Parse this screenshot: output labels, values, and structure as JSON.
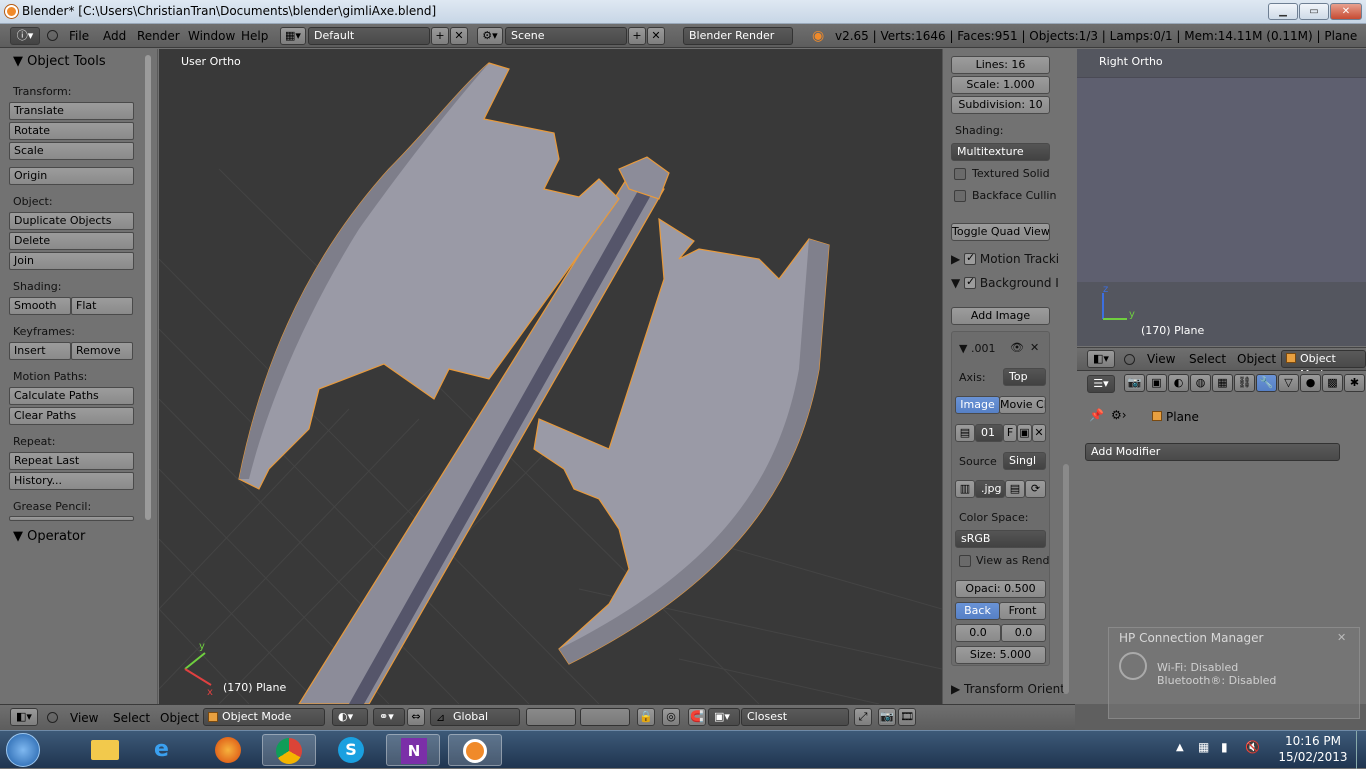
{
  "window": {
    "title": "Blender* [C:\\Users\\ChristianTran\\Documents\\blender\\gimliAxe.blend]",
    "minimize": "▁",
    "maximize": "▭",
    "close": "✕"
  },
  "topbar": {
    "menus": [
      "File",
      "Add",
      "Render",
      "Window",
      "Help"
    ],
    "screen_layout": "Default",
    "scene": "Scene",
    "render_engine": "Blender Render",
    "stats": "v2.65 | Verts:1646 | Faces:951 | Objects:1/3 | Lamps:0/1 | Mem:14.11M (0.11M) | Plane"
  },
  "tool_panel": {
    "title": "Object Tools",
    "transform_label": "Transform:",
    "translate": "Translate",
    "rotate": "Rotate",
    "scale": "Scale",
    "origin": "Origin",
    "object_label": "Object:",
    "duplicate": "Duplicate Objects",
    "delete": "Delete",
    "join": "Join",
    "shading_label": "Shading:",
    "smooth": "Smooth",
    "flat": "Flat",
    "keyframes_label": "Keyframes:",
    "insert": "Insert",
    "remove": "Remove",
    "motion_label": "Motion Paths:",
    "calc_paths": "Calculate Paths",
    "clear_paths": "Clear Paths",
    "repeat_label": "Repeat:",
    "repeat_last": "Repeat Last",
    "history": "History...",
    "grease_label": "Grease Pencil:",
    "operator": "Operator"
  },
  "viewport": {
    "label": "User Ortho",
    "object": "(170) Plane",
    "axis_x": "x",
    "axis_y": "y"
  },
  "props_panel": {
    "lines": "Lines: 16",
    "scale": "Scale: 1.000",
    "subdivision": "Subdivision: 10",
    "shading_label": "Shading:",
    "shading_value": "Multitexture",
    "textured_solid": "Textured Solid",
    "backface": "Backface Cullin",
    "toggle_quad": "Toggle Quad View",
    "motion_tracking": "Motion Tracki",
    "background": "Background I",
    "add_image": "Add Image",
    "image_slot": ".001",
    "axis_label": "Axis:",
    "axis_value": "Top",
    "tab_image": "Image",
    "tab_movie": "Movie Cli",
    "image_name": "01",
    "image_f": "F",
    "source_label": "Source",
    "source_value": "Singl",
    "file_ext": ".jpg",
    "colorspace_label": "Color Space:",
    "colorspace_value": "sRGB",
    "view_as_render": "View as Rend",
    "opacity": "Opaci: 0.500",
    "back": "Back",
    "front": "Front",
    "offset_x": "0.0",
    "offset_y": "0.0",
    "size": "Size: 5.000",
    "transform_orient": "Transform Orient"
  },
  "right_view": {
    "label": "Right Ortho",
    "object": "(170) Plane",
    "axis_z": "z",
    "axis_y": "y"
  },
  "right_header": {
    "menus": [
      "View",
      "Select",
      "Object"
    ],
    "mode": "Object Mode"
  },
  "modifier_panel": {
    "object_name": "Plane",
    "add_modifier": "Add Modifier"
  },
  "bottombar": {
    "menus": [
      "View",
      "Select",
      "Object"
    ],
    "mode": "Object Mode",
    "orientation": "Global",
    "snap": "Closest"
  },
  "notification": {
    "title": "HP Connection Manager",
    "line1": "Wi-Fi: Disabled",
    "line2": "Bluetooth®: Disabled"
  },
  "taskbar": {
    "time": "10:16 PM",
    "date": "15/02/2013"
  }
}
